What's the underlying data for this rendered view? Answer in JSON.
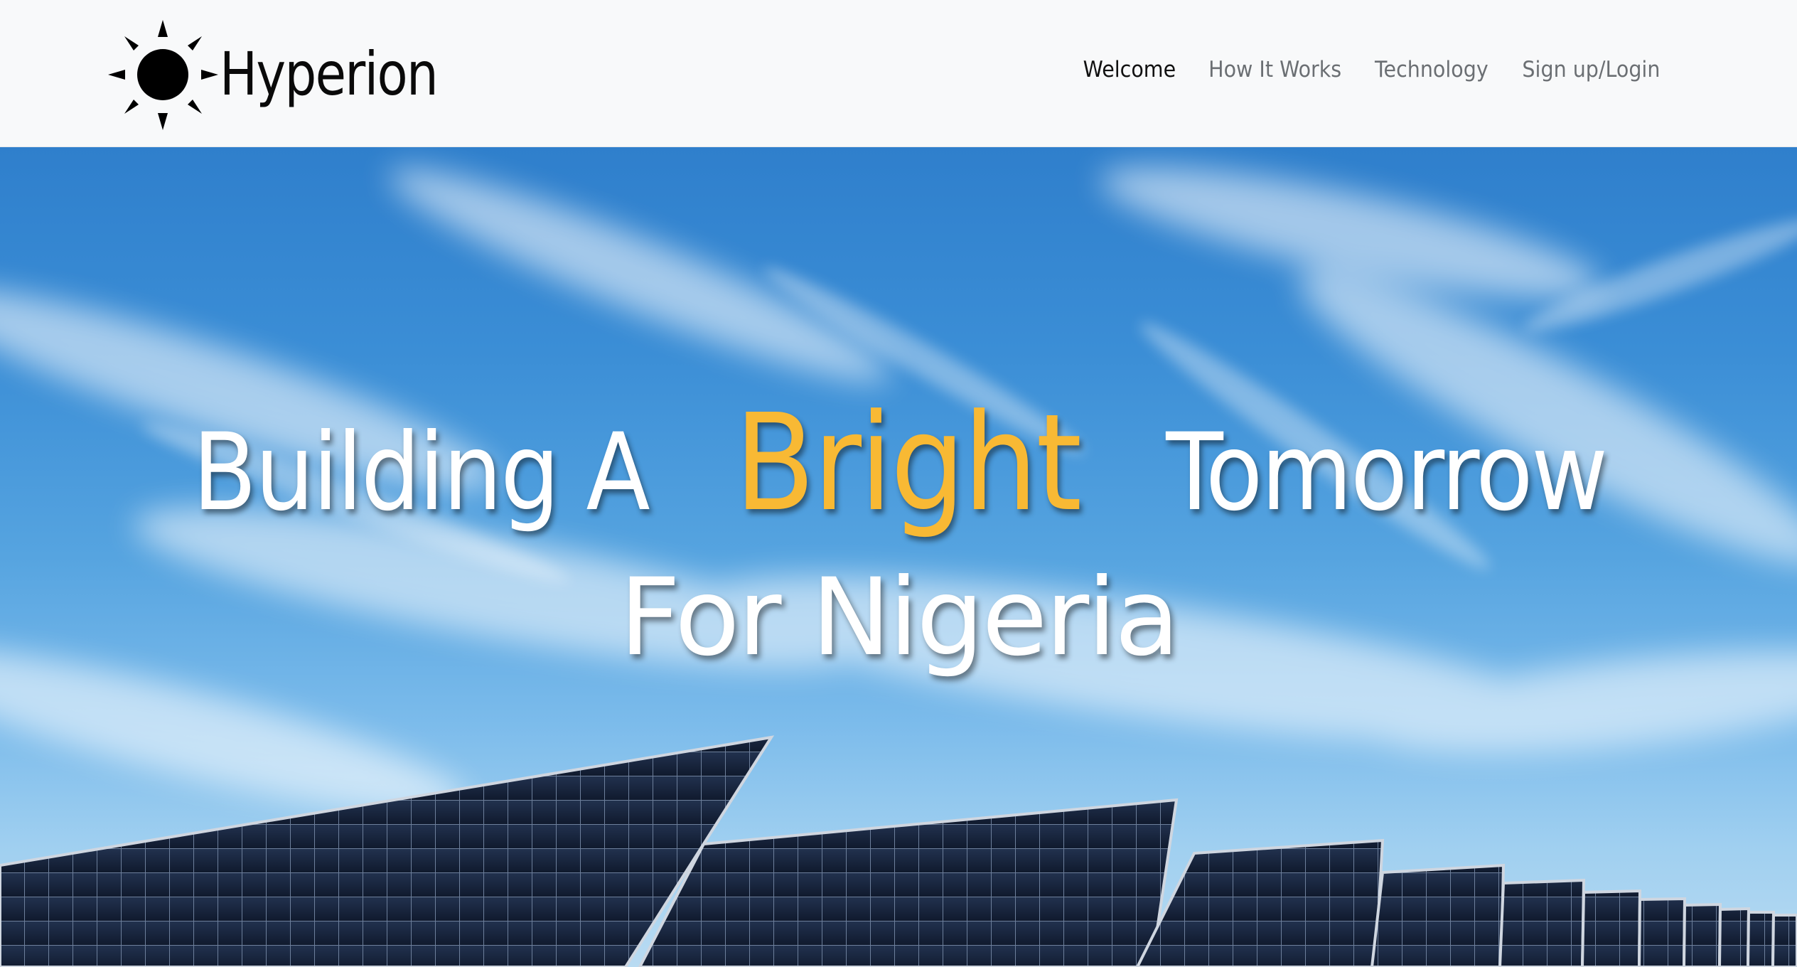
{
  "navbar": {
    "brand": {
      "logo_icon": "sun-icon",
      "name": "Hyperion"
    },
    "links": [
      {
        "label": "Welcome",
        "active": true
      },
      {
        "label": "How It Works",
        "active": false
      },
      {
        "label": "Technology",
        "active": false
      },
      {
        "label": "Sign up/Login",
        "active": false
      }
    ]
  },
  "hero": {
    "headline": {
      "part1": "Building A",
      "highlight": "Bright",
      "part2": "Tomorrow",
      "line2": "For Nigeria"
    },
    "background": "solar-panels-under-blue-sky",
    "colors": {
      "highlight": "#f8b934",
      "headline_text": "#ffffff"
    }
  }
}
